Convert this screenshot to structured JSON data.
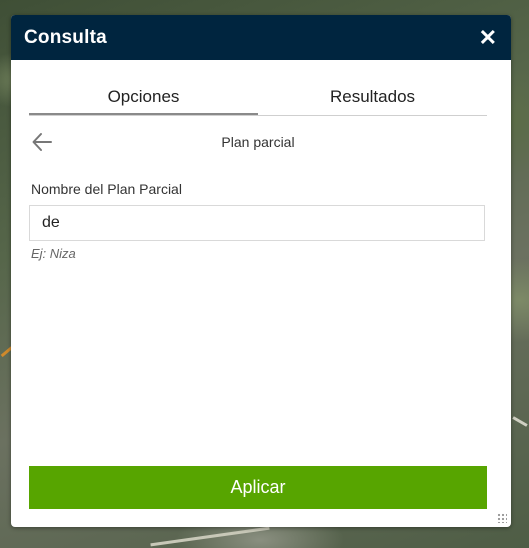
{
  "window": {
    "title": "Consulta",
    "close_icon": "close-icon"
  },
  "tabs": [
    {
      "label": "Opciones",
      "active": true
    },
    {
      "label": "Resultados",
      "active": false
    }
  ],
  "subheader": {
    "back_icon": "arrow-left-icon",
    "title": "Plan parcial"
  },
  "form": {
    "label": "Nombre del Plan Parcial",
    "value": "de",
    "hint": "Ej: Niza"
  },
  "apply_button": {
    "label": "Aplicar",
    "color": "#57a500"
  },
  "colors": {
    "titlebar": "#00253f"
  }
}
